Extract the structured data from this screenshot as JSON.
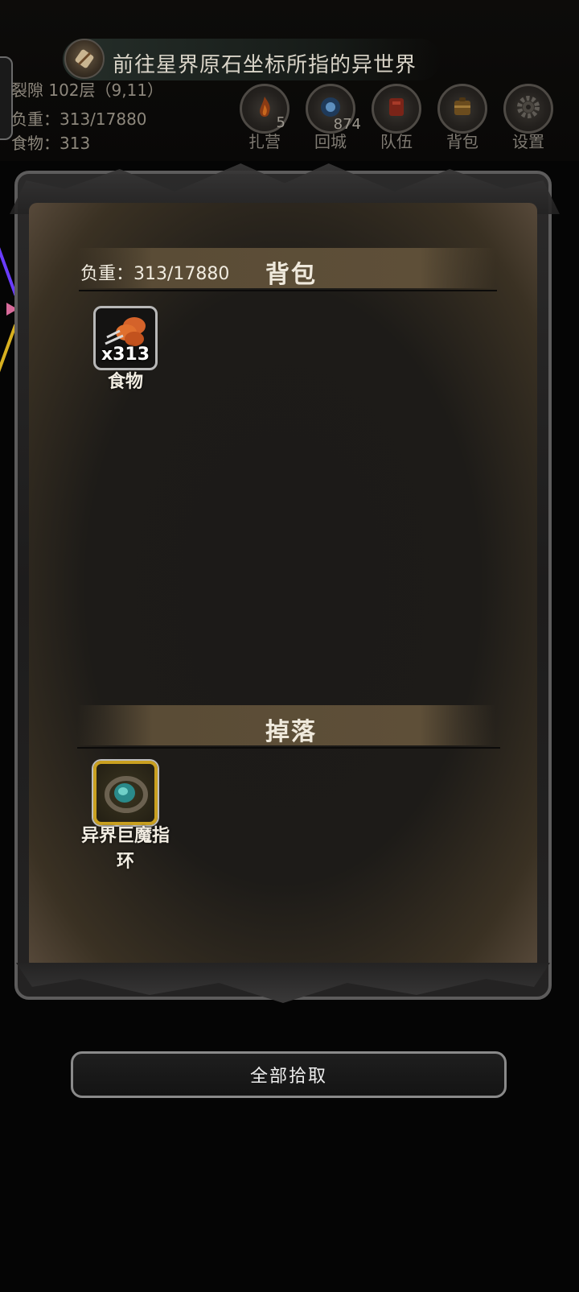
{
  "quest": {
    "text": "前往星界原石坐标所指的异世界",
    "icon": "scroll-icon"
  },
  "status": {
    "location": "裂隙 102层（9,11）",
    "weight": "负重：313/17880",
    "food": "食物：313"
  },
  "hud_buttons": [
    {
      "label": "扎营",
      "count": "5",
      "icon": "campfire-icon"
    },
    {
      "label": "回城",
      "count": "874",
      "icon": "portal-icon"
    },
    {
      "label": "队伍",
      "count": "",
      "icon": "team-icon"
    },
    {
      "label": "背包",
      "count": "",
      "icon": "backpack-icon"
    },
    {
      "label": "设置",
      "count": "",
      "icon": "gear-icon"
    }
  ],
  "backpack": {
    "title": "背包",
    "weight": "负重：313/17880",
    "items": [
      {
        "name": "食物",
        "qty": "x313",
        "icon": "food-meat-icon"
      }
    ]
  },
  "drops": {
    "title": "掉落",
    "items": [
      {
        "name": "异界巨魔指\n环",
        "line1": "异界巨魔指",
        "line2": "环",
        "icon": "gem-ring-icon"
      }
    ]
  },
  "pickup_all": "全部拾取",
  "colors": {
    "rare_border": "#c9a020",
    "band": "#5a4c36"
  }
}
